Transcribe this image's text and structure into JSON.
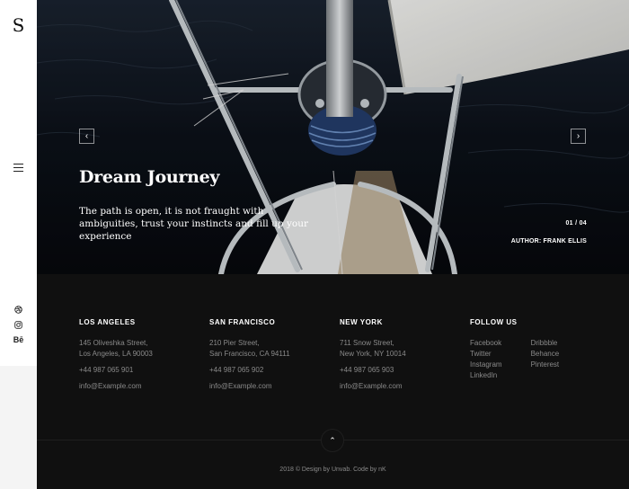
{
  "sidebar": {
    "logo": "S",
    "social": [
      "dribbble-icon",
      "instagram-icon",
      "Bē"
    ]
  },
  "hero": {
    "prev_icon": "‹",
    "next_icon": "›",
    "title": "Dream Journey",
    "text": "The path is open, it is not fraught with ambiguities, trust your instincts and fill up your experience",
    "counter": "01 / 04",
    "author": "AUTHOR: FRANK ELLIS"
  },
  "footer": {
    "locations": [
      {
        "city": "LOS ANGELES",
        "addr1": "145 Oliveshka Street,",
        "addr2": "Los Angeles, LA 90003",
        "phone": "+44 987 065 901",
        "email": "info@Example.com"
      },
      {
        "city": "SAN FRANCISCO",
        "addr1": "210 Pier Street,",
        "addr2": "San Francisco, CA 94111",
        "phone": "+44 987 065 902",
        "email": "info@Example.com"
      },
      {
        "city": "NEW YORK",
        "addr1": "711 Snow Street,",
        "addr2": "New York, NY 10014",
        "phone": "+44 987 065 903",
        "email": "info@Example.com"
      }
    ],
    "follow": {
      "title": "FOLLOW US",
      "col1": [
        "Facebook",
        "Twitter",
        "Instagram",
        "LinkedIn"
      ],
      "col2": [
        "Dribbble",
        "Behance",
        "Pinterest"
      ]
    },
    "top_icon": "⌃",
    "copyright": "2018 © Design by Unvab. Code by nK"
  }
}
